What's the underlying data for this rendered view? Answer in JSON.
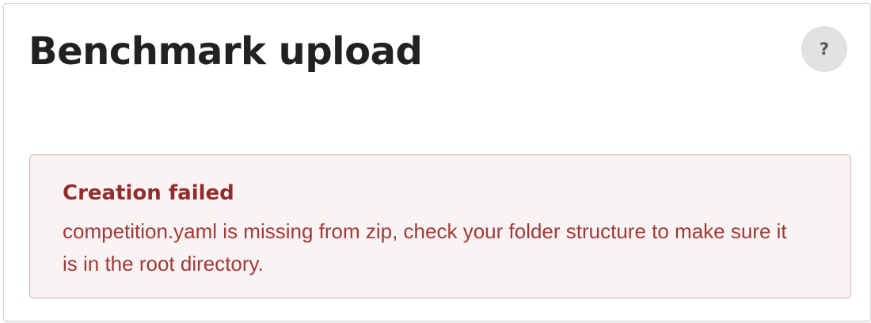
{
  "page": {
    "title": "Benchmark upload"
  },
  "help_button": {
    "label": "?",
    "icon": "help-icon"
  },
  "error_message": {
    "header": "Creation failed",
    "body": "competition.yaml is missing from zip, check your folder structure to make sure it is in the root directory."
  },
  "colors": {
    "title_text": "#212121",
    "help_button_bg": "#e1e1e1",
    "help_glyph": "#555555",
    "error_bg": "#faf3f3",
    "error_border": "#dcb3b1",
    "error_header": "#912d2b",
    "error_body": "#9f3a38"
  }
}
